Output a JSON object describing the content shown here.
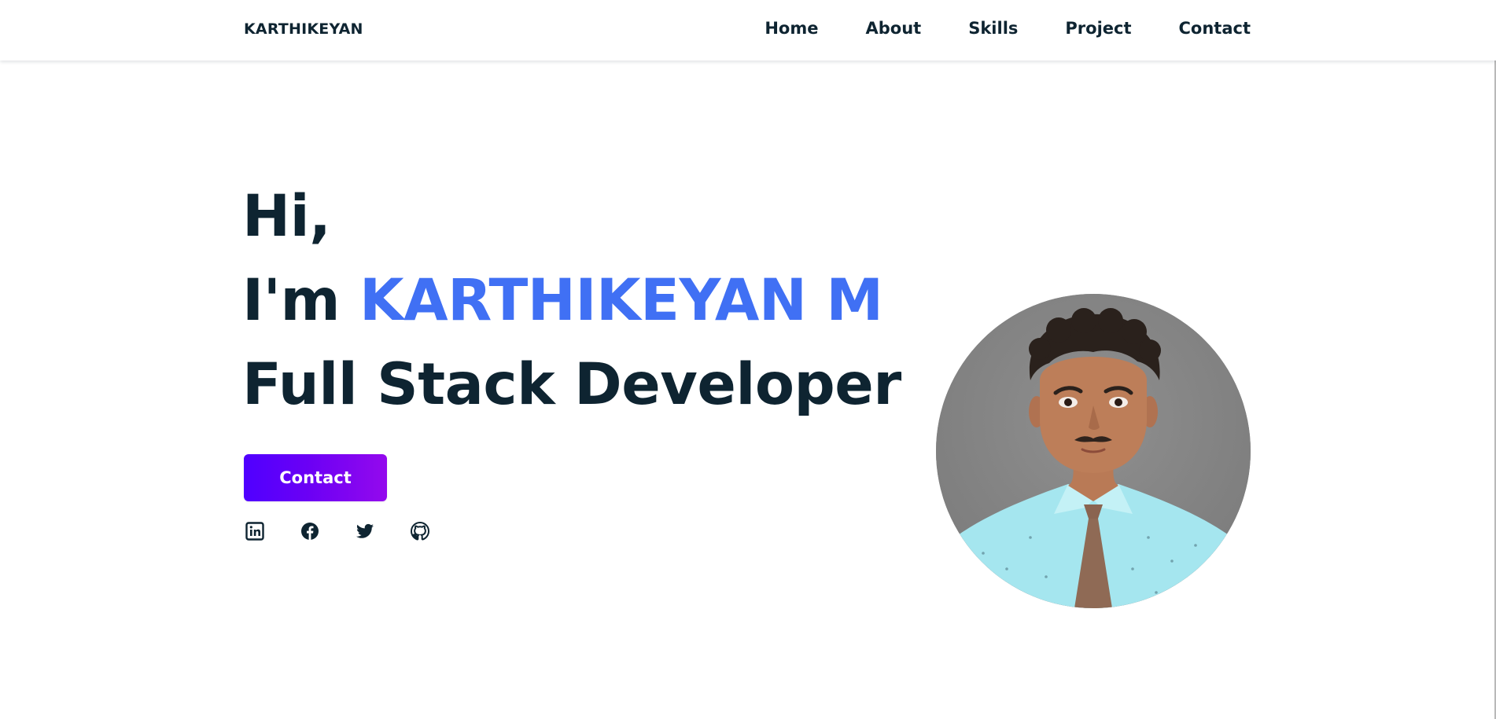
{
  "header": {
    "logo": "KARTHIKEYAN",
    "nav": [
      {
        "label": "Home"
      },
      {
        "label": "About"
      },
      {
        "label": "Skills"
      },
      {
        "label": "Project"
      },
      {
        "label": "Contact"
      }
    ]
  },
  "hero": {
    "greeting": "Hi,",
    "intro": "I'm ",
    "name": "KARTHIKEYAN M",
    "role": "Full Stack Developer",
    "contact_button": "Contact"
  },
  "social": [
    {
      "icon": "linkedin-icon"
    },
    {
      "icon": "facebook-icon"
    },
    {
      "icon": "twitter-icon"
    },
    {
      "icon": "github-icon"
    }
  ],
  "colors": {
    "text": "#0e2431",
    "accent": "#4070f4",
    "button_gradient_start": "#4f00ff",
    "button_gradient_end": "#9409ed"
  }
}
